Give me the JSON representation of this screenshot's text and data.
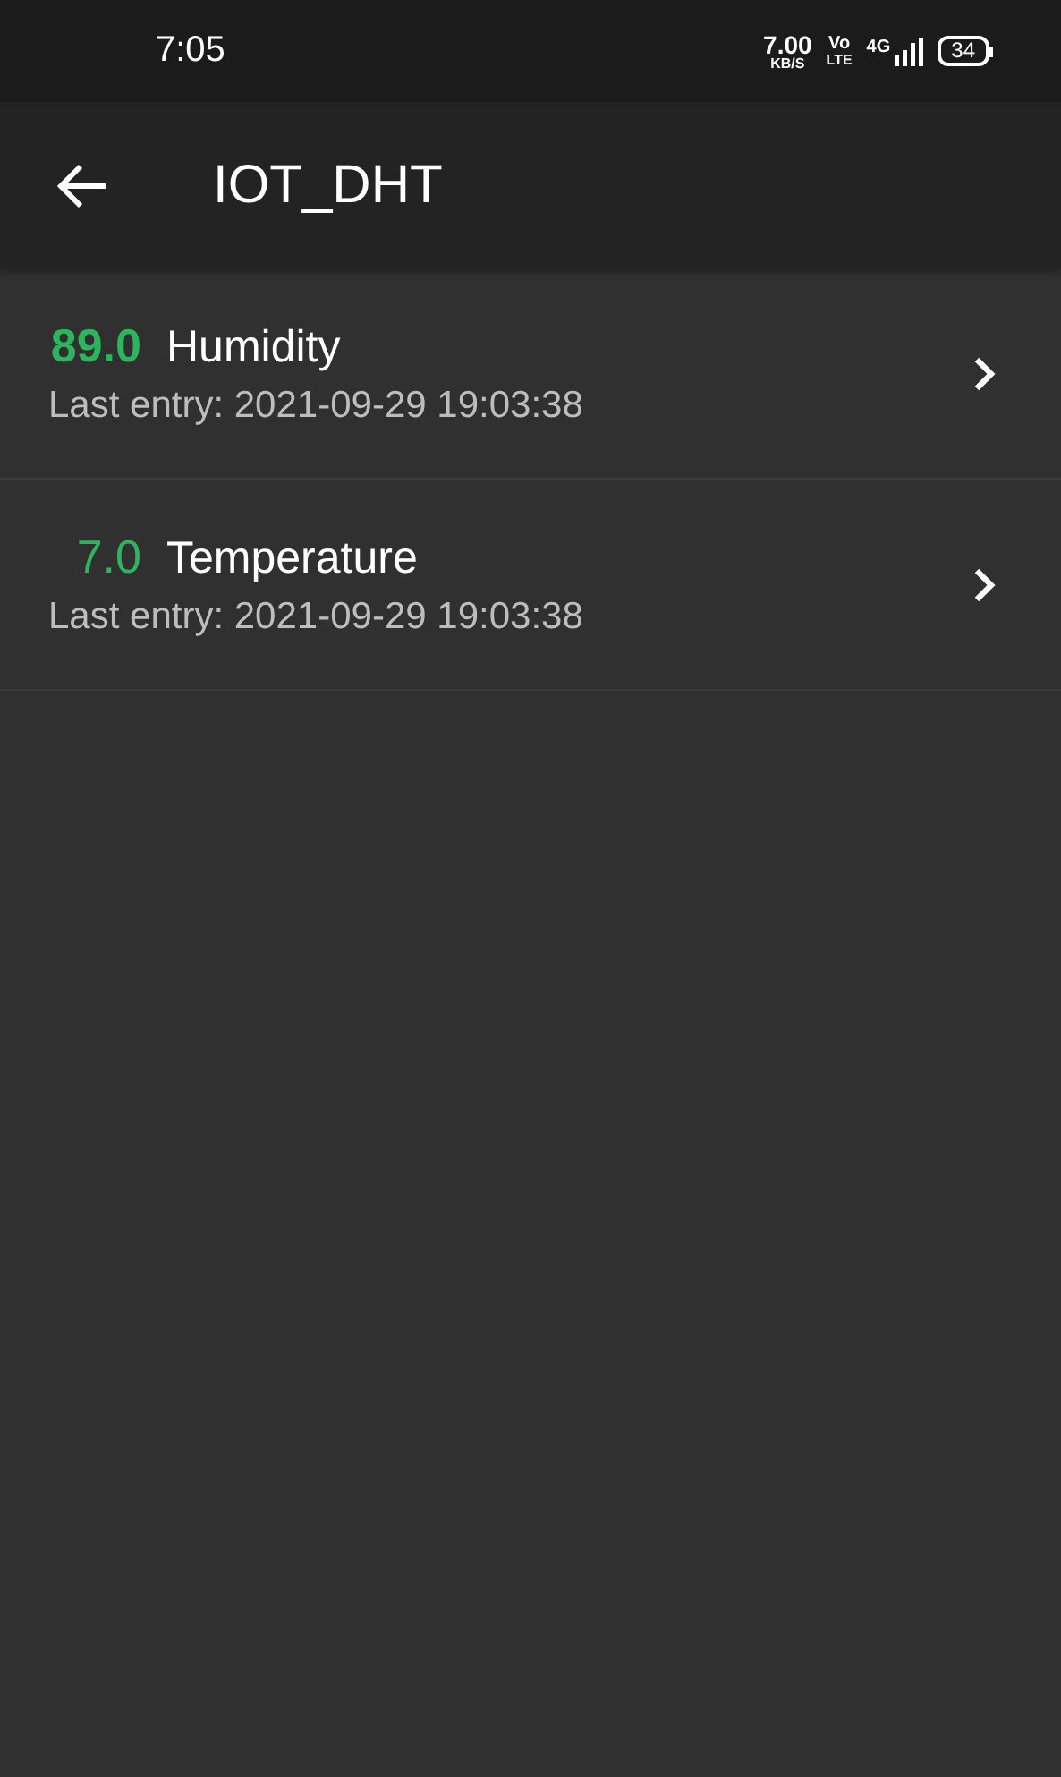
{
  "status_bar": {
    "time": "7:05",
    "speed": "7.00",
    "speed_unit": "KB/S",
    "volte_top": "Vo",
    "volte_bottom": "LTE",
    "network": "4G",
    "battery": "34"
  },
  "app_bar": {
    "title": "IOT_DHT"
  },
  "channels": [
    {
      "value": "89.0",
      "name": "Humidity",
      "last_entry": "Last entry: 2021-09-29 19:03:38",
      "emphasized": true
    },
    {
      "value": "7.0",
      "name": "Temperature",
      "last_entry": "Last entry: 2021-09-29 19:03:38",
      "emphasized": false
    }
  ]
}
